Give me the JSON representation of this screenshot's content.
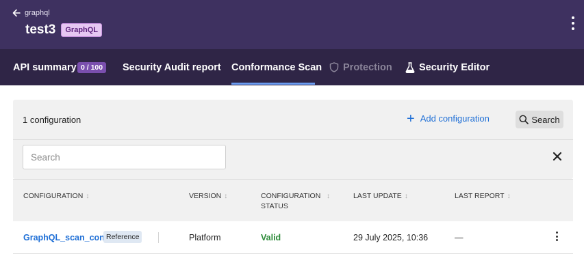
{
  "header": {
    "back_label": "graphql",
    "api_title": "test3",
    "api_type_badge": "GraphQL"
  },
  "tabs": [
    {
      "label": "API summary",
      "badge": "0 / 100"
    },
    {
      "label": "Security Audit report"
    },
    {
      "label": "Conformance Scan",
      "active": true
    },
    {
      "label": "Protection",
      "disabled": true,
      "icon": "shield-icon"
    },
    {
      "label": "Security Editor",
      "icon": "flask-icon"
    }
  ],
  "toolbar": {
    "config_count": "1 configuration",
    "add_label": "Add configuration",
    "search_label": "Search",
    "search_placeholder": "Search"
  },
  "table": {
    "columns": [
      "CONFIGURATION",
      "VERSION",
      "CONFIGURATION STATUS",
      "LAST UPDATE",
      "LAST REPORT"
    ],
    "rows": [
      {
        "name": "GraphQL_scan_conf",
        "tag": "Reference",
        "version": "Platform",
        "status": "Valid",
        "last_update": "29 July 2025, 10:36",
        "last_report": "—"
      }
    ]
  },
  "colors": {
    "header_bg": "#3e3160",
    "tabs_bg": "#2f2546",
    "accent_blue": "#1f6fd6",
    "active_tab_underline": "#6b9cf0",
    "valid_green": "#2e8b3a",
    "count_badge_bg": "#7a4fae"
  }
}
